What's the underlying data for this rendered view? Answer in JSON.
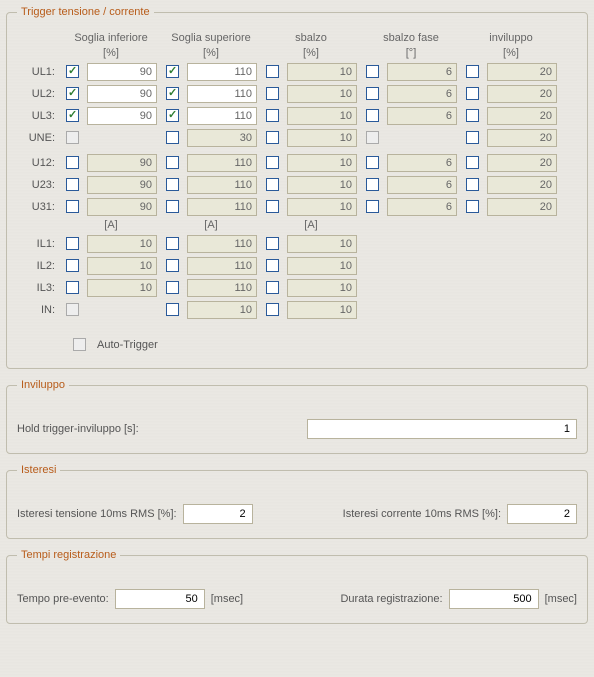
{
  "section1": {
    "legend": "Trigger tensione / corrente",
    "headers": [
      "Soglia inferiore",
      "Soglia superiore",
      "sbalzo",
      "sbalzo fase",
      "inviluppo"
    ],
    "units_pct": "[%]",
    "units_deg": "[°]",
    "units_a": "[A]",
    "rows_v": [
      {
        "label": "UL1:",
        "c1": true,
        "v1": "90",
        "c2": true,
        "v2": "110",
        "c3": false,
        "v3": "10",
        "c4": false,
        "v4": "6",
        "c5": false,
        "v5": "20"
      },
      {
        "label": "UL2:",
        "c1": true,
        "v1": "90",
        "c2": true,
        "v2": "110",
        "c3": false,
        "v3": "10",
        "c4": false,
        "v4": "6",
        "c5": false,
        "v5": "20"
      },
      {
        "label": "UL3:",
        "c1": true,
        "v1": "90",
        "c2": true,
        "v2": "110",
        "c3": false,
        "v3": "10",
        "c4": false,
        "v4": "6",
        "c5": false,
        "v5": "20"
      },
      {
        "label": "UNE:",
        "c1g": true,
        "v1": "",
        "c2": false,
        "v2": "30",
        "c3": false,
        "v3": "10",
        "c4g": true,
        "v4": "",
        "c5": false,
        "v5": "20"
      }
    ],
    "rows_uu": [
      {
        "label": "U12:",
        "c1": false,
        "v1": "90",
        "c2": false,
        "v2": "110",
        "c3": false,
        "v3": "10",
        "c4": false,
        "v4": "6",
        "c5": false,
        "v5": "20"
      },
      {
        "label": "U23:",
        "c1": false,
        "v1": "90",
        "c2": false,
        "v2": "110",
        "c3": false,
        "v3": "10",
        "c4": false,
        "v4": "6",
        "c5": false,
        "v5": "20"
      },
      {
        "label": "U31:",
        "c1": false,
        "v1": "90",
        "c2": false,
        "v2": "110",
        "c3": false,
        "v3": "10",
        "c4": false,
        "v4": "6",
        "c5": false,
        "v5": "20"
      }
    ],
    "rows_i": [
      {
        "label": "IL1:",
        "c1": false,
        "v1": "10",
        "c2": false,
        "v2": "110",
        "c3": false,
        "v3": "10"
      },
      {
        "label": "IL2:",
        "c1": false,
        "v1": "10",
        "c2": false,
        "v2": "110",
        "c3": false,
        "v3": "10"
      },
      {
        "label": "IL3:",
        "c1": false,
        "v1": "10",
        "c2": false,
        "v2": "110",
        "c3": false,
        "v3": "10"
      },
      {
        "label": "IN:",
        "c1g": true,
        "v1": "",
        "c2": false,
        "v2": "10",
        "c3": false,
        "v3": "10"
      }
    ],
    "auto_trigger_label": "Auto-Trigger"
  },
  "section2": {
    "legend": "Inviluppo",
    "label": "Hold trigger-inviluppo [s]:",
    "value": "1"
  },
  "section3": {
    "legend": "Isteresi",
    "label1": "Isteresi tensione 10ms RMS [%]:",
    "value1": "2",
    "label2": "Isteresi corrente 10ms RMS [%]:",
    "value2": "2"
  },
  "section4": {
    "legend": "Tempi registrazione",
    "label1": "Tempo pre-evento:",
    "value1": "50",
    "unit1": "[msec]",
    "label2": "Durata registrazione:",
    "value2": "500",
    "unit2": "[msec]"
  }
}
